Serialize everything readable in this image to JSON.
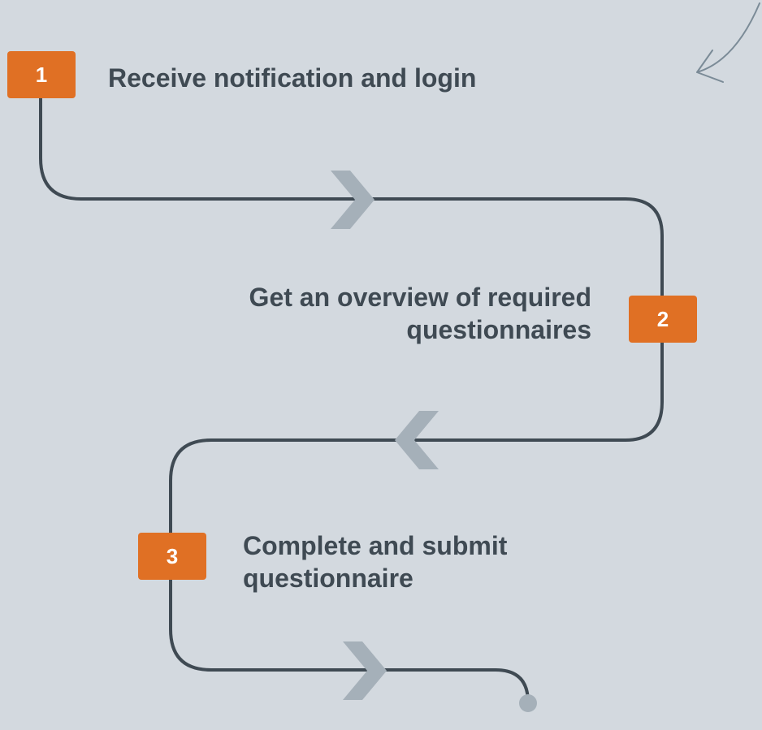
{
  "steps": [
    {
      "number": "1",
      "text": "Receive notification and login"
    },
    {
      "number": "2",
      "text": "Get an overview of required questionnaires"
    },
    {
      "number": "3",
      "text": "Complete and submit questionnaire"
    }
  ],
  "colors": {
    "background": "#d3d9df",
    "badge": "#e07024",
    "badge_text": "#ffffff",
    "line": "#3f4a53",
    "chevron": "#a5b0b9",
    "text": "#3f4a53",
    "sketch_arrow": "#7b8b97"
  }
}
